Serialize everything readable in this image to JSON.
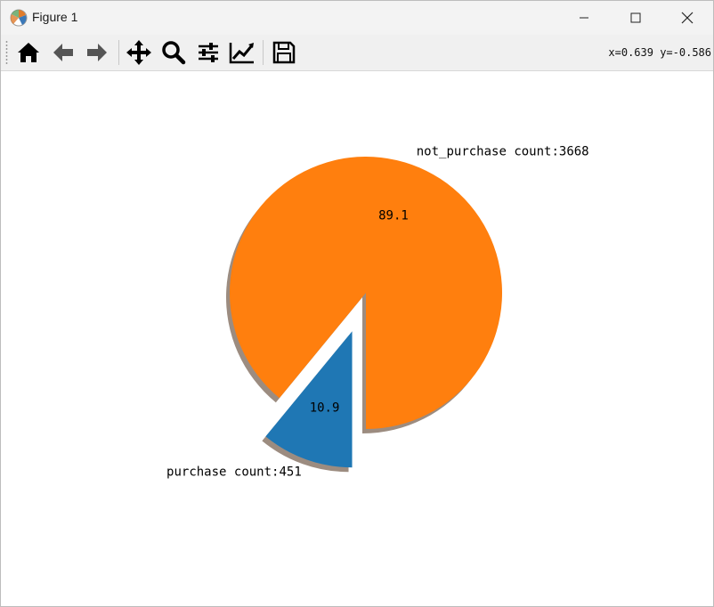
{
  "window": {
    "title": "Figure 1"
  },
  "toolbar": {
    "buttons": [
      {
        "name": "home-icon",
        "label": "Home"
      },
      {
        "name": "back-icon",
        "label": "Back"
      },
      {
        "name": "forward-icon",
        "label": "Forward"
      },
      {
        "name": "pan-icon",
        "label": "Pan"
      },
      {
        "name": "zoom-icon",
        "label": "Zoom"
      },
      {
        "name": "configure-subplots-icon",
        "label": "Subplots"
      },
      {
        "name": "edit-axis-icon",
        "label": "Customize"
      },
      {
        "name": "save-icon",
        "label": "Save"
      }
    ],
    "coordinates": "x=0.639 y=-0.586"
  },
  "colors": {
    "not_purchase": "#ff7f0e",
    "purchase": "#1f77b4",
    "shadow": "#9c8c80"
  },
  "chart_data": {
    "type": "pie",
    "title": "",
    "labels": [
      "not_purchase count:3668",
      "purchase count:451"
    ],
    "values": [
      3668,
      451
    ],
    "autopct": [
      "89.1",
      "10.9"
    ],
    "explode": [
      0,
      0.3
    ],
    "shadow": true,
    "startangle": 270
  }
}
